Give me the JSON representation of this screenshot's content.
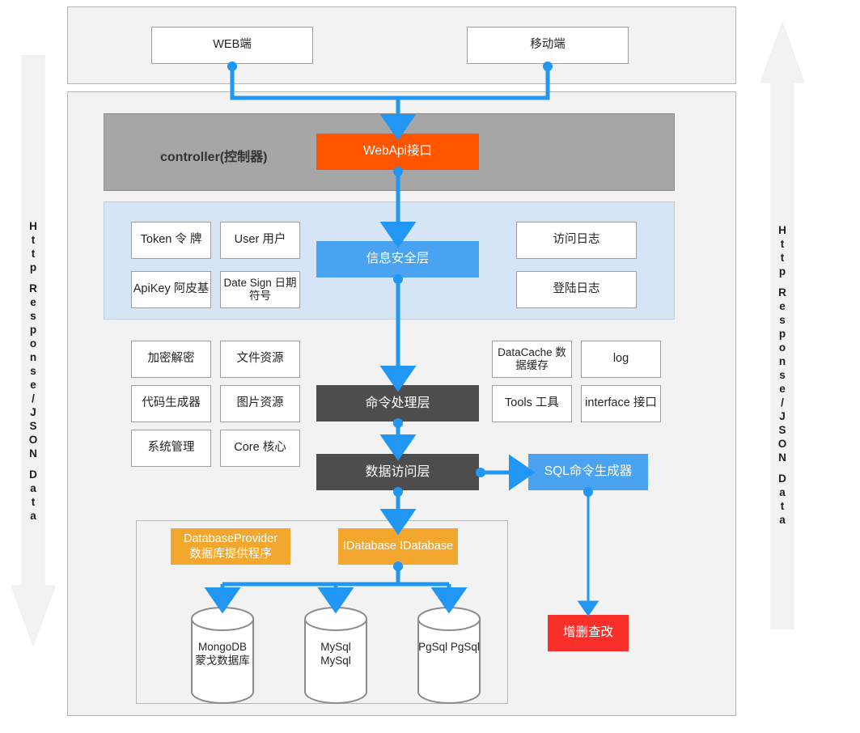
{
  "colors": {
    "accent_blue": "#4aa3f0",
    "connector_blue": "#2196f3",
    "orange_red": "#ff5500",
    "amber": "#f3a72e",
    "red": "#fb2f2a",
    "dark_gray": "#4d4d4d",
    "band_gray": "#a6a6a6",
    "band_light_blue": "#d6e5f5",
    "panel_bg": "#f2f2f2"
  },
  "side_arrows": {
    "left": {
      "text": "Http Response/JSON Data",
      "direction": "down"
    },
    "right": {
      "text": "Http Response/JSON Data",
      "direction": "up"
    }
  },
  "client_layer": {
    "nodes": [
      {
        "label": "WEB端"
      },
      {
        "label": "移动端"
      }
    ]
  },
  "controller_layer": {
    "title": "controller(控制器)",
    "entry": {
      "label": "WebApi接口"
    }
  },
  "security_layer": {
    "center": {
      "label": "信息安全层"
    },
    "left_items": [
      {
        "label": "Token 令 牌"
      },
      {
        "label": "User 用户"
      },
      {
        "label": "ApiKey 阿皮基"
      },
      {
        "label": "Date Sign 日期符号"
      }
    ],
    "right_items": [
      {
        "label": "访问日志"
      },
      {
        "label": "登陆日志"
      }
    ]
  },
  "core_layer": {
    "left_items": [
      {
        "label": "加密解密"
      },
      {
        "label": "文件资源"
      },
      {
        "label": "代码生成器"
      },
      {
        "label": "图片资源"
      },
      {
        "label": "系统管理"
      },
      {
        "label": "Core 核心"
      }
    ],
    "right_items": [
      {
        "label": "DataCache 数据缓存"
      },
      {
        "label": "log"
      },
      {
        "label": "Tools 工具"
      },
      {
        "label": "interface 接口"
      }
    ],
    "command_layer": {
      "label": "命令处理层"
    },
    "data_access_layer": {
      "label": "数据访问层"
    },
    "sql_builder": {
      "label": "SQL命令生成器"
    },
    "crud": {
      "label": "增删查改"
    }
  },
  "database_layer": {
    "provider": {
      "label": "DatabaseProvider\n数据库提供程序"
    },
    "interface": {
      "label": "IDatabase IDatabase"
    },
    "databases": [
      {
        "label": "MongoDB\n蒙戈数据库"
      },
      {
        "label": "MySql MySql"
      },
      {
        "label": "PgSql PgSql"
      }
    ]
  }
}
